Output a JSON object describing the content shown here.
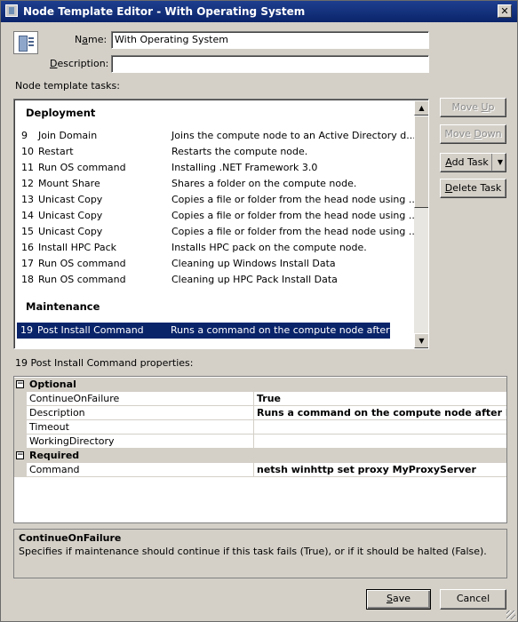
{
  "window": {
    "title": "Node Template Editor - With Operating System",
    "close_glyph": "✕"
  },
  "form": {
    "name_label_pre": "N",
    "name_label_access": "a",
    "name_label_post": "me:",
    "name_value": "With Operating System",
    "desc_label_access": "D",
    "desc_label_post": "escription:",
    "desc_value": "",
    "tasks_label": "Node template tasks:"
  },
  "tasks": {
    "deployment_header": "Deployment",
    "maintenance_header": "Maintenance",
    "rows": [
      {
        "num": "9",
        "name": "Join Domain",
        "desc": "Joins the compute node to an Active Directory d..."
      },
      {
        "num": "10",
        "name": "Restart",
        "desc": "Restarts the compute node."
      },
      {
        "num": "11",
        "name": "Run OS command",
        "desc": "Installing .NET Framework 3.0"
      },
      {
        "num": "12",
        "name": "Mount Share",
        "desc": "Shares a folder on the compute node."
      },
      {
        "num": "13",
        "name": "Unicast Copy",
        "desc": "Copies a file or folder from the head node using ..."
      },
      {
        "num": "14",
        "name": "Unicast Copy",
        "desc": "Copies a file or folder from the head node using ..."
      },
      {
        "num": "15",
        "name": "Unicast Copy",
        "desc": "Copies a file or folder from the head node using ..."
      },
      {
        "num": "16",
        "name": "Install HPC Pack",
        "desc": "Installs HPC pack on the compute node."
      },
      {
        "num": "17",
        "name": "Run OS command",
        "desc": "Cleaning up Windows Install Data"
      },
      {
        "num": "18",
        "name": "Run OS command",
        "desc": "Cleaning up HPC Pack Install Data"
      }
    ],
    "maintenance_rows": [
      {
        "num": "19",
        "name": "Post Install Command",
        "desc": "Runs a command on the compute node after HP..."
      }
    ]
  },
  "buttons": {
    "move_up_pre": "Move ",
    "move_up_access": "U",
    "move_up_post": "p",
    "move_down_pre": "Move ",
    "move_down_access": "D",
    "move_down_post": "own",
    "add_task_access": "A",
    "add_task_post": "dd Task",
    "delete_task_access": "D",
    "delete_task_post": "elete Task",
    "save_access": "S",
    "save_post": "ave",
    "cancel": "Cancel"
  },
  "properties": {
    "title": "19 Post Install Command properties:",
    "categories": [
      {
        "name": "Optional",
        "expander": "−",
        "items": [
          {
            "name": "ContinueOnFailure",
            "value": "True"
          },
          {
            "name": "Description",
            "value": "Runs a command on the compute node after HPC"
          },
          {
            "name": "Timeout",
            "value": ""
          },
          {
            "name": "WorkingDirectory",
            "value": ""
          }
        ]
      },
      {
        "name": "Required",
        "expander": "−",
        "items": [
          {
            "name": "Command",
            "value": "netsh winhttp set proxy MyProxyServer"
          }
        ]
      }
    ]
  },
  "help": {
    "title": "ContinueOnFailure",
    "text": "Specifies if maintenance should continue if this task fails (True), or if it should be halted (False)."
  },
  "colors": {
    "selection": "#0a246a",
    "titlebar": "#0a246a",
    "face": "#d4d0c8"
  }
}
